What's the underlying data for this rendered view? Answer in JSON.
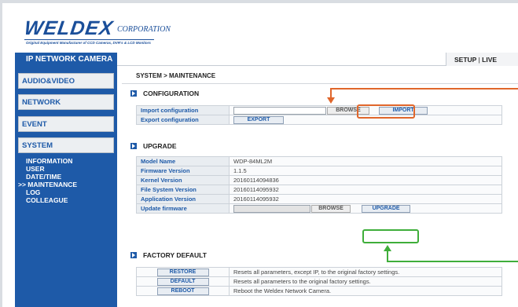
{
  "brand": {
    "name": "WELDEX",
    "suffix": "CORPORATION",
    "tagline": "Original Equipment Manufacturer of CCD Cameras, DVR's & LCD Monitors"
  },
  "topbar": {
    "title": "IP NETWORK CAMERA",
    "setup": "SETUP",
    "separator": "|",
    "live": "LIVE"
  },
  "sidebar": {
    "items": [
      {
        "label": "AUDIO&VIDEO"
      },
      {
        "label": "NETWORK"
      },
      {
        "label": "EVENT"
      },
      {
        "label": "SYSTEM"
      }
    ],
    "subitems": [
      {
        "label": "INFORMATION"
      },
      {
        "label": "USER"
      },
      {
        "label": "DATE/TIME"
      },
      {
        "label": ">> MAINTENANCE"
      },
      {
        "label": "LOG"
      },
      {
        "label": "COLLEAGUE"
      }
    ]
  },
  "main": {
    "breadcrumb": "SYSTEM > MAINTENANCE",
    "configuration": {
      "title": "CONFIGURATION",
      "import_label": "Import configuration",
      "export_label": "Export configuration",
      "browse": "BROWSE",
      "import_btn": "IMPORT",
      "export_btn": "EXPORT"
    },
    "upgrade": {
      "title": "UPGRADE",
      "rows": [
        {
          "label": "Model Name",
          "value": "WDP-84ML2M"
        },
        {
          "label": "Firmware Version",
          "value": "1.1.5"
        },
        {
          "label": "Kernel Version",
          "value": "20160114094836"
        },
        {
          "label": "File System Version",
          "value": "20160114095932"
        },
        {
          "label": "Application Version",
          "value": "20160114095932"
        }
      ],
      "update_label": "Update firmware",
      "browse": "BROWSE",
      "upgrade_btn": "UPGRADE"
    },
    "factory": {
      "title": "FACTORY DEFAULT",
      "rows": [
        {
          "button": "RESTORE",
          "desc": "Resets all parameters, except IP, to the original factory settings."
        },
        {
          "button": "DEFAULT",
          "desc": "Resets all parameters to the original factory settings."
        },
        {
          "button": "REBOOT",
          "desc": "Reboot the Weldex Network Camera."
        }
      ]
    }
  },
  "colors": {
    "accent": "#1e5aa8",
    "import_highlight": "#e0662b",
    "upgrade_highlight": "#3fae3a"
  }
}
